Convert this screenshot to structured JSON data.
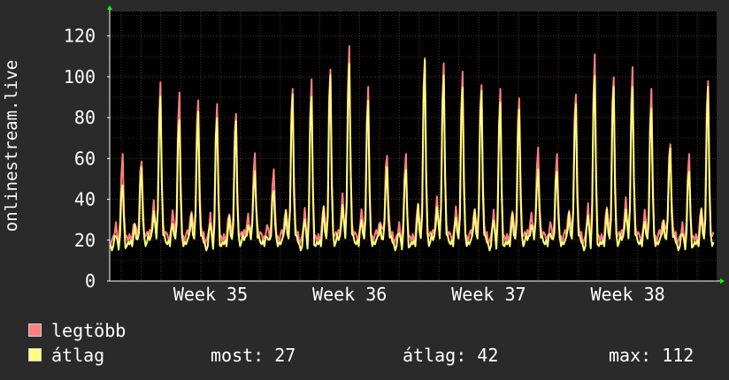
{
  "chart_data": {
    "type": "line",
    "ylabel": "onlinestream.live",
    "x_ticks": [
      "Week 35",
      "Week 36",
      "Week 37",
      "Week 38"
    ],
    "y_ticks": [
      0,
      20,
      40,
      60,
      80,
      100,
      120
    ],
    "ylim": [
      0,
      132
    ],
    "grid": true,
    "series": [
      {
        "name": "legtöbb",
        "color": "#ff7f7f",
        "daily_peaks": [
          64,
          62,
          100,
          97,
          95,
          90,
          87,
          63,
          57,
          101,
          103,
          110,
          119,
          100,
          66,
          64,
          116,
          110,
          108,
          103,
          98,
          95,
          66,
          65,
          98,
          116,
          106,
          108,
          99,
          72,
          64,
          104
        ]
      },
      {
        "name": "átlag",
        "color": "#ffff7f",
        "daily_peaks": [
          50,
          56,
          95,
          85,
          86,
          85,
          80,
          56,
          48,
          95,
          96,
          104,
          112,
          95,
          57,
          58,
          112,
          106,
          102,
          97,
          93,
          86,
          57,
          58,
          90,
          107,
          98,
          100,
          91,
          67,
          57,
          98
        ]
      }
    ],
    "legend_position": "bottom-left"
  },
  "legend": {
    "max_label": "legtöbb",
    "avg_label": "átlag",
    "max_color": "#ff7f7f",
    "avg_color": "#ffff7f"
  },
  "stats": {
    "current": "most: 27",
    "average": "átlag: 42",
    "maximum": "max: 112"
  }
}
